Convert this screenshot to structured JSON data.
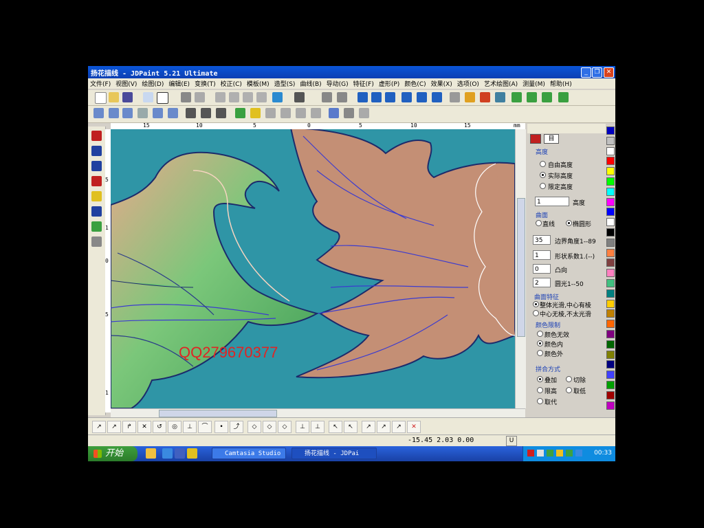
{
  "window": {
    "title": "扬花描线 - JDPaint 5.21 Ultimate",
    "minimize": "_",
    "restore": "❐",
    "close": "✕"
  },
  "menu": [
    "文件(F)",
    "视图(V)",
    "绘图(D)",
    "编辑(E)",
    "变换(T)",
    "校正(C)",
    "模板(M)",
    "造型(S)",
    "曲线(B)",
    "导动(G)",
    "特征(F)",
    "虚形(P)",
    "颜色(C)",
    "效果(X)",
    "选项(O)",
    "艺术绘图(A)",
    "测量(M)",
    "帮助(H)"
  ],
  "ruler": {
    "unit": "mm",
    "h_labels": [
      "15",
      "10",
      "5",
      "0",
      "5",
      "10",
      "15"
    ],
    "v_labels": [
      "5",
      "1",
      "0",
      "5",
      "1"
    ]
  },
  "canvas": {
    "watermark": "QQ279670377",
    "background": "#2f95a6"
  },
  "panel": {
    "tabs": [
      "",
      "目"
    ],
    "height_group": "高度",
    "height_opts": [
      "自由高度",
      "实际高度",
      "限定高度"
    ],
    "height_selected": 1,
    "height_value": "1",
    "height_unit": "高度",
    "curve_group": "曲面",
    "curve_opts": [
      "直线",
      "椭圆形"
    ],
    "curve_selected": 1,
    "angle_value": "35",
    "angle_label": "边界角度1--89",
    "shape_value": "1",
    "shape_label": "形状系数1.(--)",
    "convex_value": "0",
    "convex_label": "凸向",
    "smooth_value": "2",
    "smooth_label": "圆光1--50",
    "opt_group": "曲面特征",
    "opt_opts": [
      "整体光滑,中心有棱",
      "中心无棱,不太光滑"
    ],
    "opt_selected": 0,
    "color_group": "颜色限制",
    "color_opts": [
      "颜色无效",
      "颜色内",
      "颜色外"
    ],
    "color_selected": 1,
    "merge_group": "拼合方式",
    "merge_opts": [
      "叠加",
      "切除",
      "限高",
      "取低",
      "取代"
    ],
    "merge_selected": 0
  },
  "palette": [
    "#0000c0",
    "#c0c0c0",
    "#fff",
    "#ff0000",
    "#ffff00",
    "#00ff00",
    "#00ffff",
    "#ff00ff",
    "#0000ff",
    "#ffffff",
    "#000000",
    "#808080",
    "#ff8040",
    "#804040",
    "#ff80c0",
    "#40c080",
    "#008080",
    "#ffcc00",
    "#c08000",
    "#ff6600",
    "#800080",
    "#006600",
    "#808000",
    "#000080",
    "#4040ff",
    "#00a000",
    "#a00000",
    "#c000c0"
  ],
  "status": {
    "coords": "-15.45 2.03 0.00",
    "mode": "U"
  },
  "taskbar": {
    "start_label": "开始",
    "tasks": [
      "Camtasia Studio ...",
      "扬花描线 - JDPai"
    ],
    "clock": "00:33"
  }
}
